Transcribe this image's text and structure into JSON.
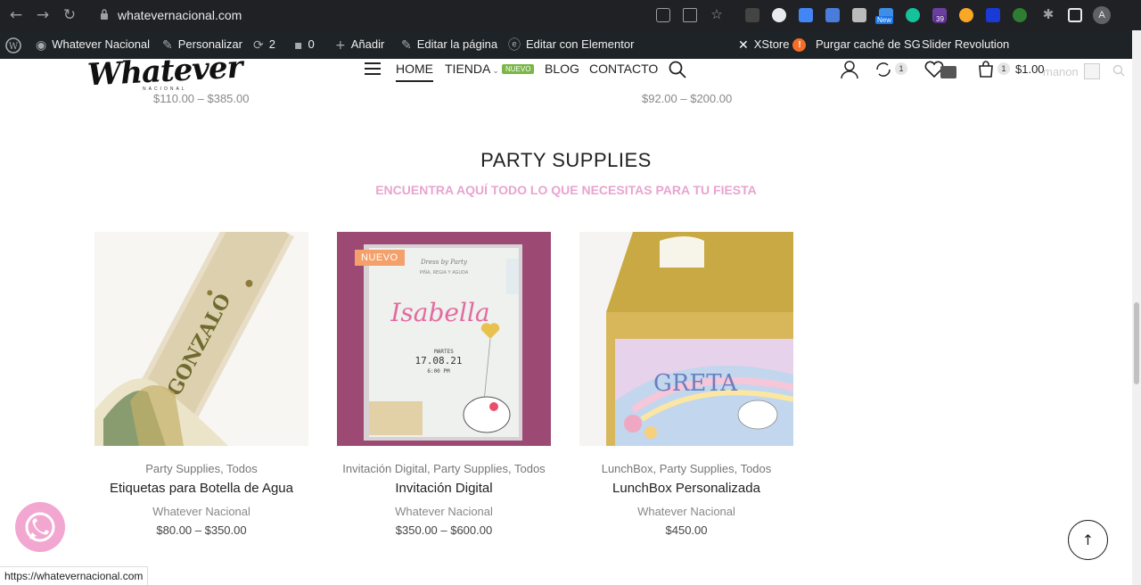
{
  "browser": {
    "url": "whatevernacional.com",
    "ext_new_label": "New",
    "ext_badge_count": "39",
    "profile_initial": "A"
  },
  "admin_bar": {
    "site_name": "Whatever Nacional",
    "customize": "Personalizar",
    "updates_count": "2",
    "comments_count": "0",
    "add_new": "Añadir",
    "edit_page": "Editar la página",
    "edit_elementor": "Editar con Elementor",
    "xstore": "XStore",
    "xstore_badge": "!",
    "purge_cache": "Purgar caché de SG",
    "slider": "Slider Revolution"
  },
  "header": {
    "logo": "Whatever",
    "logo_sub": "NACIONAL",
    "nav": {
      "home": "HOME",
      "tienda": "TIENDA",
      "tienda_badge": "NUEVO",
      "blog": "BLOG",
      "contacto": "CONTACTO"
    },
    "compare_count": "1",
    "cart_count": "1",
    "cart_total": "$1.00",
    "user_greeting": "manon"
  },
  "partial_prices": [
    "$110.00 – $385.00",
    "$92.00 – $200.00"
  ],
  "section": {
    "title": "PARTY SUPPLIES",
    "subtitle": "ENCUENTRA AQUÍ TODO LO QUE NECESITAS PARA TU FIESTA"
  },
  "products": [
    {
      "categories": "Party Supplies, Todos",
      "title": "Etiquetas para Botella de Agua",
      "brand": "Whatever Nacional",
      "price": "$80.00 – $350.00",
      "image_text": "GONZALO"
    },
    {
      "categories": "Invitación Digital, Party Supplies, Todos",
      "title": "Invitación Digital",
      "brand": "Whatever Nacional",
      "price": "$350.00 – $600.00",
      "badge": "NUEVO",
      "invite_script": "Dress by Party",
      "invite_line": "PIÑA, REGIA Y AGUDA",
      "invite_name": "Isabella",
      "invite_day": "MARTES",
      "invite_date": "17.08.21",
      "invite_time": "6:00 PM"
    },
    {
      "categories": "LunchBox, Party Supplies, Todos",
      "title": "LunchBox Personalizada",
      "brand": "Whatever Nacional",
      "price": "$450.00",
      "image_text": "GRETA"
    }
  ],
  "status_url": "https://whatevernacional.com"
}
